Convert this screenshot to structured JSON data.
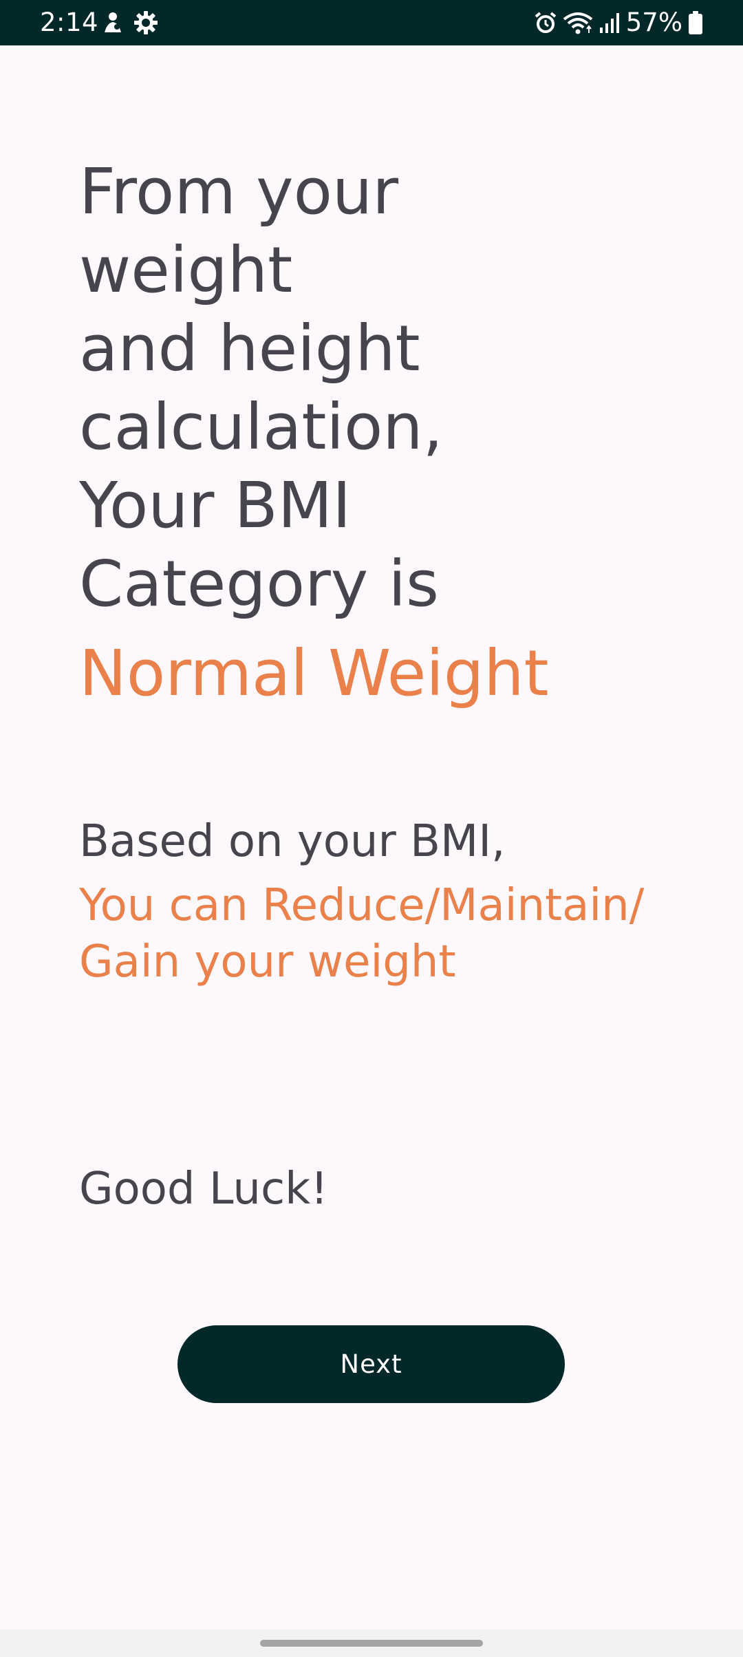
{
  "status_bar": {
    "time": "2:14",
    "battery_percent": "57%",
    "left_icons": [
      "mascot-icon",
      "settings-gear-icon"
    ],
    "right_icons": [
      "alarm-icon",
      "wifi-icon",
      "signal-icon",
      "battery-icon"
    ]
  },
  "result": {
    "headline_lines": [
      "From your",
      "weight",
      "and height",
      "calculation,",
      "Your BMI",
      "Category is"
    ],
    "category": "Normal Weight"
  },
  "advice": {
    "intro": "Based on your BMI,",
    "lines": [
      "You can Reduce/Maintain/",
      "Gain your weight"
    ]
  },
  "closing": "Good Luck!",
  "actions": {
    "next_label": "Next"
  },
  "colors": {
    "background": "#fcf8fb",
    "primary_dark": "#03282a",
    "accent_orange": "#ea804a",
    "text_dark": "#46444d"
  }
}
